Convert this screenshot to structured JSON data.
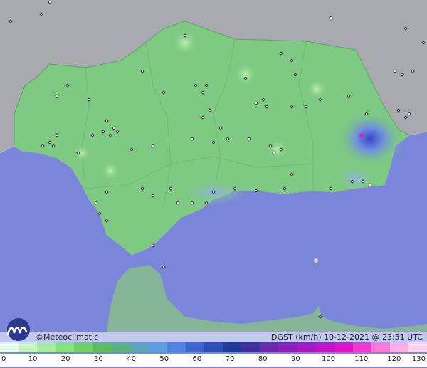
{
  "map": {
    "brand": "©Meteoclimatic",
    "variable": "DGST (km/h)",
    "timestamp": "10-12-2021 @ 23:51 UTC",
    "scale_ticks": [
      "0",
      "10",
      "20",
      "30",
      "40",
      "50",
      "60",
      "70",
      "80",
      "90",
      "100",
      "110",
      "120",
      "130"
    ],
    "scale_colors": [
      "#e9fbe9",
      "#c8f3c6",
      "#a6ec9f",
      "#86e07e",
      "#6fd06a",
      "#5dbb61",
      "#58b283",
      "#5aa6b8",
      "#5b9edf",
      "#4d84e0",
      "#3d66cf",
      "#2f4fb6",
      "#1f3a98",
      "#3e2f9a",
      "#6a2bab",
      "#8b21b8",
      "#a719c2",
      "#c214c9",
      "#dc13c9",
      "#ee3ad2",
      "#f77ad9",
      "#fab0e3",
      "#fcd6ee"
    ],
    "colors": {
      "sea": "#7a86d9",
      "land_andalusia": "#7fca82",
      "land_outside": "#a9aab0",
      "africa": "#86b98e"
    }
  }
}
